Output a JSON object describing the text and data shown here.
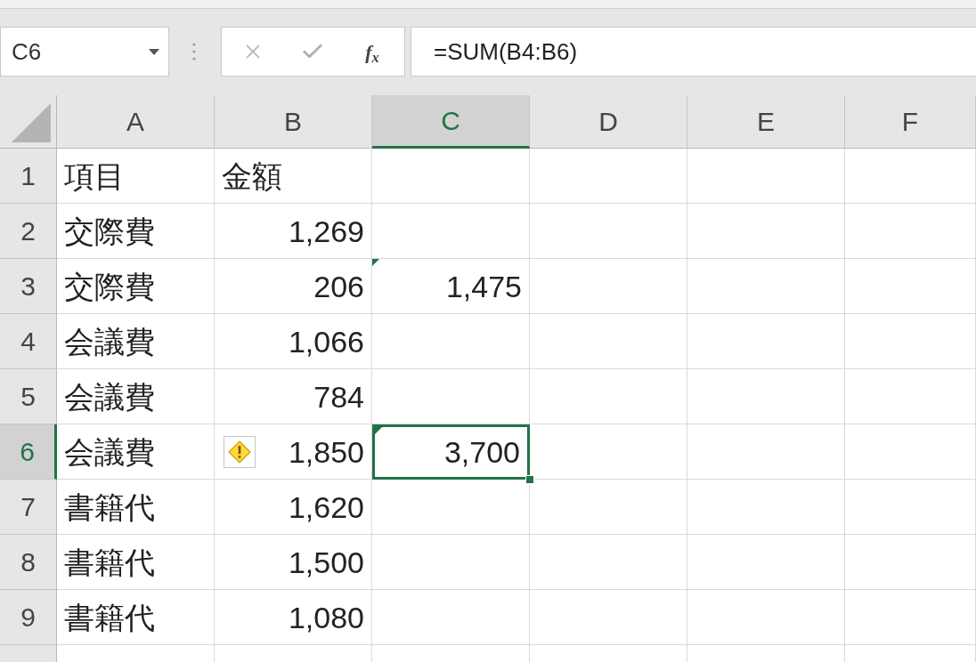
{
  "name_box": {
    "value": "C6"
  },
  "formula_bar": {
    "cancel": {
      "disabled": true
    },
    "enter": {
      "disabled": true
    },
    "function_label": "f$_{x}$",
    "formula": "=SUM(B4:B6)"
  },
  "columns": [
    {
      "label": "A",
      "selected": false
    },
    {
      "label": "B",
      "selected": false
    },
    {
      "label": "C",
      "selected": true
    },
    {
      "label": "D",
      "selected": false
    },
    {
      "label": "E",
      "selected": false
    },
    {
      "label": "F",
      "selected": false
    }
  ],
  "rows": [
    {
      "label": "1",
      "selected": false,
      "column_a": {
        "kind": "text",
        "text": "項目",
        "flagged": false,
        "selected": false
      },
      "column_b": {
        "kind": "text",
        "text": "金額",
        "flagged": false,
        "selected": false
      }
    },
    {
      "label": "2",
      "selected": false,
      "column_a": {
        "kind": "text",
        "text": "交際費",
        "flagged": false,
        "selected": false
      },
      "column_b": {
        "kind": "number",
        "text": "1,269",
        "flagged": false,
        "selected": false
      }
    },
    {
      "label": "3",
      "selected": false,
      "column_a": {
        "kind": "text",
        "text": "交際費",
        "flagged": false,
        "selected": false
      },
      "column_b": {
        "kind": "number",
        "text": "206",
        "flagged": false,
        "selected": false
      },
      "column_c": {
        "kind": "number",
        "text": "1,475",
        "flagged": true,
        "selected": false
      }
    },
    {
      "label": "4",
      "selected": false,
      "column_a": {
        "kind": "text",
        "text": "会議費",
        "flagged": false,
        "selected": false
      },
      "column_b": {
        "kind": "number",
        "text": "1,066",
        "flagged": false,
        "selected": false
      }
    },
    {
      "label": "5",
      "selected": false,
      "column_a": {
        "kind": "text",
        "text": "会議費",
        "flagged": false,
        "selected": false
      },
      "column_b": {
        "kind": "number",
        "text": "784",
        "flagged": false,
        "selected": false
      }
    },
    {
      "label": "6",
      "selected": true,
      "column_a": {
        "kind": "text",
        "text": "会議費",
        "flagged": false,
        "selected": false
      },
      "column_b": {
        "kind": "number",
        "text": "1,850",
        "flagged": false,
        "selected": false
      },
      "column_c": {
        "kind": "number",
        "text": "3,700",
        "flagged": true,
        "selected": true
      }
    },
    {
      "label": "7",
      "selected": false,
      "column_a": {
        "kind": "text",
        "text": "書籍代",
        "flagged": false,
        "selected": false
      },
      "column_b": {
        "kind": "number",
        "text": "1,620",
        "flagged": false,
        "selected": false
      }
    },
    {
      "label": "8",
      "selected": false,
      "column_a": {
        "kind": "text",
        "text": "書籍代",
        "flagged": false,
        "selected": false
      },
      "column_b": {
        "kind": "number",
        "text": "1,500",
        "flagged": false,
        "selected": false
      }
    },
    {
      "label": "9",
      "selected": false,
      "column_a": {
        "kind": "text",
        "text": "書籍代",
        "flagged": false,
        "selected": false
      },
      "column_b": {
        "kind": "number",
        "text": "1,080",
        "flagged": false,
        "selected": false
      }
    }
  ]
}
